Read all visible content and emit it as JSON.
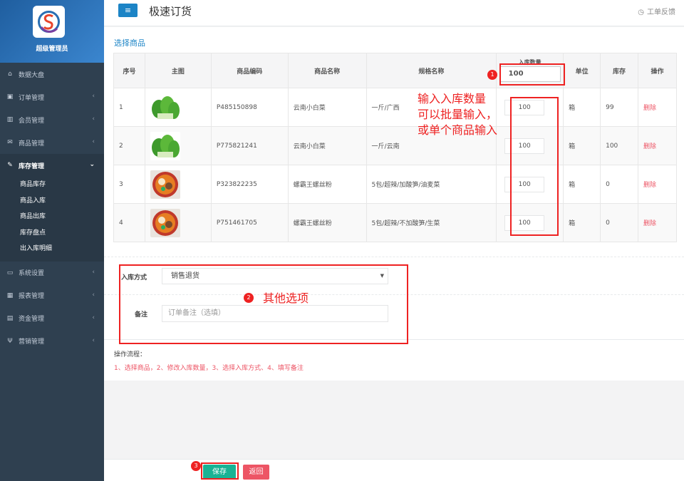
{
  "sidebar": {
    "brand_name": "超级管理员",
    "menu": [
      {
        "label": "数据大盘",
        "icon": "home-icon"
      },
      {
        "label": "订单管理",
        "icon": "order-icon"
      },
      {
        "label": "会员管理",
        "icon": "chart-icon"
      },
      {
        "label": "商品管理",
        "icon": "envelope-icon"
      },
      {
        "label": "库存管理",
        "icon": "edit-icon"
      },
      {
        "label": "系统设置",
        "icon": "desktop-icon"
      },
      {
        "label": "报表管理",
        "icon": "bar-chart-icon"
      },
      {
        "label": "资金管理",
        "icon": "wallet-icon"
      },
      {
        "label": "营销管理",
        "icon": "cutlery-icon"
      }
    ],
    "submenu": [
      "商品库存",
      "商品入库",
      "商品出库",
      "库存盘点",
      "出入库明细"
    ]
  },
  "topbar": {
    "title": "极速订货",
    "feedback": "工单反馈"
  },
  "section_title": "选择商品",
  "table": {
    "headers": [
      "序号",
      "主图",
      "商品编码",
      "商品名称",
      "规格名称",
      "入库数量",
      "单位",
      "库存",
      "操作"
    ],
    "header_qty_value": "100",
    "rows": [
      {
        "no": "1",
        "code": "P485150898",
        "name": "云南小白菜",
        "spec": "一斤/广西",
        "qty": "100",
        "unit": "箱",
        "stock": "99",
        "action": "删除",
        "image": "cabbage"
      },
      {
        "no": "2",
        "code": "P775821241",
        "name": "云南小白菜",
        "spec": "一斤/云南",
        "qty": "100",
        "unit": "箱",
        "stock": "100",
        "action": "删除",
        "image": "cabbage"
      },
      {
        "no": "3",
        "code": "P323822235",
        "name": "螺霸王螺丝粉",
        "spec": "5包/超辣/加酸笋/油麦菜",
        "qty": "100",
        "unit": "箱",
        "stock": "0",
        "action": "删除",
        "image": "noodle"
      },
      {
        "no": "4",
        "code": "P751461705",
        "name": "螺霸王螺丝粉",
        "spec": "5包/超辣/不加酸笋/生菜",
        "qty": "100",
        "unit": "箱",
        "stock": "0",
        "action": "删除",
        "image": "noodle"
      }
    ]
  },
  "form": {
    "method_label": "入库方式",
    "method_value": "销售退货",
    "remark_label": "备注",
    "remark_placeholder": "订单备注（选填）"
  },
  "flow": {
    "title": "操作流程：",
    "steps": "1、选择商品，2、修改入库数量，3、选择入库方式、4、填写备注"
  },
  "footer": {
    "save": "保存",
    "back": "返回"
  },
  "annotations": {
    "note1": "输入入库数量\n可以批量输入，\n或单个商品输入",
    "note2": "其他选项",
    "num1": "1",
    "num2": "2",
    "num3": "3"
  },
  "colors": {
    "sidebar": "#2f4050",
    "primary": "#1c84c6",
    "save": "#1ab394",
    "danger": "#ed5565",
    "annotation": "#ee2222"
  }
}
